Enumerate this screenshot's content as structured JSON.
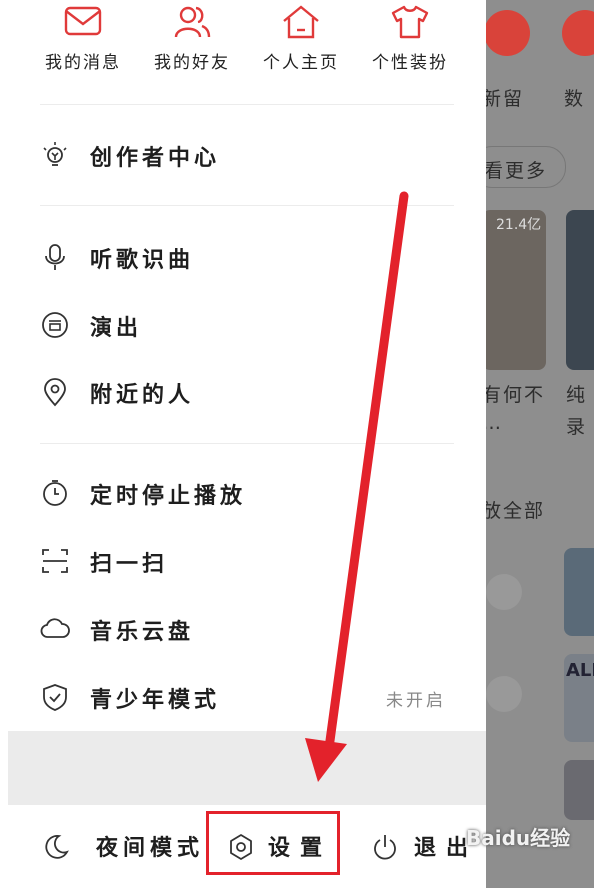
{
  "quick_actions": [
    {
      "label": "我的消息",
      "icon": "mail-icon"
    },
    {
      "label": "我的好友",
      "icon": "friends-icon"
    },
    {
      "label": "个人主页",
      "icon": "home-icon"
    },
    {
      "label": "个性装扮",
      "icon": "tshirt-icon"
    }
  ],
  "menu": {
    "creator": "创作者中心",
    "song_recognition": "听歌识曲",
    "shows": "演出",
    "nearby": "附近的人",
    "sleep_timer": "定时停止播放",
    "scan": "扫一扫",
    "cloud_drive": "音乐云盘",
    "teen_mode": "青少年模式",
    "teen_mode_status": "未开启"
  },
  "bottom_bar": {
    "night_mode": "夜间模式",
    "settings": "设置",
    "logout": "退出"
  },
  "background": {
    "tab1": "新留",
    "tab2": "数",
    "more": "看更多",
    "play_count": "21.4亿",
    "card1": "有何不",
    "card1_more": "…",
    "card2_line1": "纯",
    "card2_line2": "录",
    "play_all": "放全部",
    "album_text": "ALE"
  },
  "watermark": "Baidu经验",
  "colors": {
    "accent": "#e3222b",
    "icon_red": "#e03a3a",
    "text": "#1e1e1e",
    "overlay": "#8e8e8e"
  }
}
